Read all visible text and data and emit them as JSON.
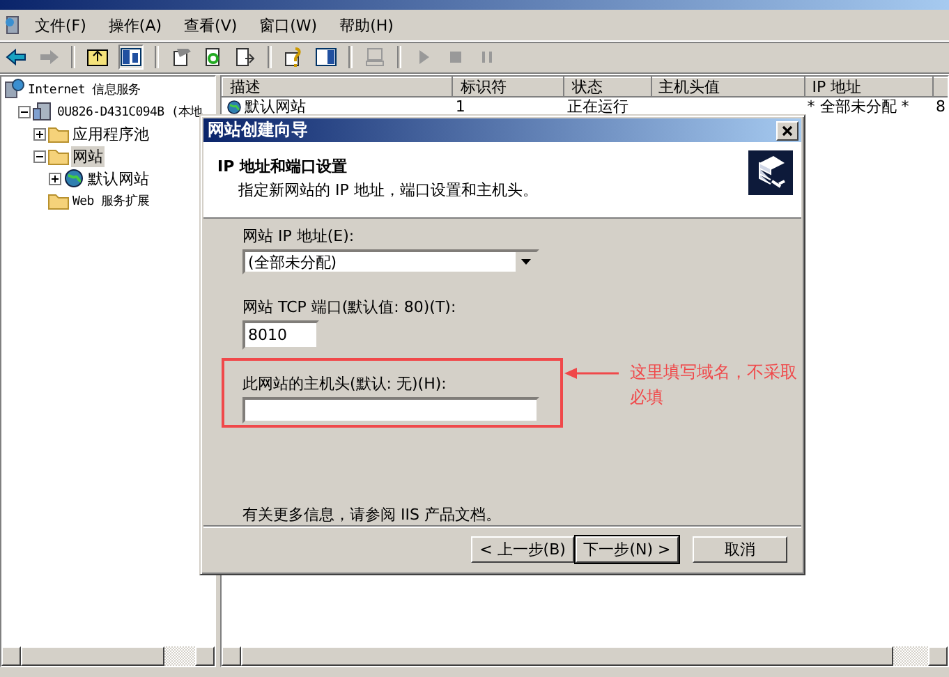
{
  "menu": [
    "文件(F)",
    "操作(A)",
    "查看(V)",
    "窗口(W)",
    "帮助(H)"
  ],
  "tree": [
    {
      "label": "Internet 信息服务",
      "kind": "service",
      "selected": false,
      "children": [
        {
          "label": "0U826-D431C094B (本地",
          "kind": "server",
          "expanded": true,
          "selected": false,
          "children": [
            {
              "label": "应用程序池",
              "kind": "folder",
              "expanded": false,
              "selected": false
            },
            {
              "label": "网站",
              "kind": "folder",
              "expanded": true,
              "selected": true,
              "children": [
                {
                  "label": "默认网站",
                  "kind": "site",
                  "expanded": false,
                  "selected": false
                }
              ]
            },
            {
              "label": "Web 服务扩展",
              "kind": "folder",
              "selected": false
            }
          ]
        }
      ]
    }
  ],
  "list": {
    "columns": [
      "描述",
      "标识符",
      "状态",
      "主机头值",
      "IP 地址"
    ],
    "rows": [
      {
        "cells": [
          "默认网站",
          "1",
          "正在运行",
          "",
          "* 全部未分配 *",
          "8"
        ]
      }
    ]
  },
  "dialog": {
    "title": "网站创建向导",
    "heading": "IP 地址和端口设置",
    "subheading": "指定新网站的 IP 地址，端口设置和主机头。",
    "ip_label": "网站 IP 地址(E):",
    "ip_value": "(全部未分配)",
    "port_label": "网站 TCP 端口(默认值: 80)(T):",
    "port_value": "8010",
    "host_label": "此网站的主机头(默认: 无)(H):",
    "info": "有关更多信息，请参阅 IIS 产品文档。",
    "buttons": [
      {
        "label": "< 上一步(B)",
        "default": false
      },
      {
        "label": "下一步(N) >",
        "default": true
      },
      {
        "label": "取消",
        "default": false
      }
    ]
  },
  "annotation": {
    "text": "这里填写域名，不采取必填"
  }
}
